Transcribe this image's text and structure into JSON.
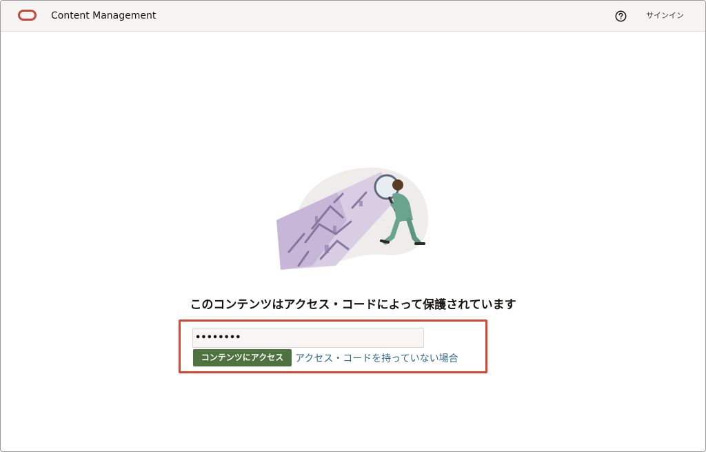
{
  "header": {
    "app_title": "Content Management",
    "help_icon": "help-circle-icon",
    "signin_label": "サインイン",
    "brand_color": "#c74634"
  },
  "main": {
    "illustration": "person-with-magnifying-glass-illustration",
    "heading": "このコンテンツはアクセス・コードによって保護されています",
    "access_code_value": "••••••••",
    "access_button_label": "コンテンツにアクセス",
    "no_code_link": "アクセス・コードを持っていない場合",
    "button_color": "#4f7340",
    "link_color": "#316a8f",
    "highlight_color": "#d9462d"
  }
}
